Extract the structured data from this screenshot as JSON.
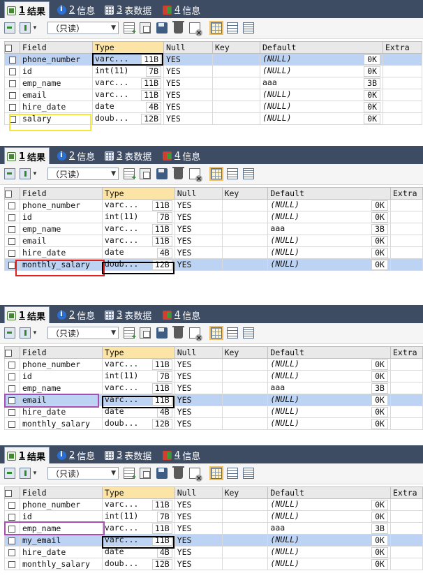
{
  "tabs": [
    {
      "num": "1",
      "label": "结果"
    },
    {
      "num": "2",
      "label": "信息"
    },
    {
      "num": "3",
      "label": "表数据"
    },
    {
      "num": "4",
      "label": "信息"
    }
  ],
  "toolbar": {
    "mode": "（只读）"
  },
  "columns": [
    "Field",
    "Type",
    "Null",
    "Key",
    "Default",
    "Extra"
  ],
  "panels": [
    {
      "highlight_color": "#f5e63a",
      "selected_row": 0,
      "highlight_row": 5,
      "rows": [
        {
          "field": "phone_number",
          "type": "varc...",
          "size": "11B",
          "null": "YES",
          "default": "(NULL)",
          "len": "0K"
        },
        {
          "field": "id",
          "type": "int(11)",
          "size": "7B",
          "null": "YES",
          "default": "(NULL)",
          "len": "0K"
        },
        {
          "field": "emp_name",
          "type": "varc...",
          "size": "11B",
          "null": "YES",
          "default": "aaa",
          "len": "3B"
        },
        {
          "field": "email",
          "type": "varc...",
          "size": "11B",
          "null": "YES",
          "default": "(NULL)",
          "len": "0K"
        },
        {
          "field": "hire_date",
          "type": "date",
          "size": "4B",
          "null": "YES",
          "default": "(NULL)",
          "len": "0K"
        },
        {
          "field": "salary",
          "type": "doub...",
          "size": "12B",
          "null": "YES",
          "default": "(NULL)",
          "len": "0K"
        }
      ]
    },
    {
      "highlight_color": "#e0201c",
      "selected_row": 5,
      "highlight_row": 5,
      "rows": [
        {
          "field": "phone_number",
          "type": "varc...",
          "size": "11B",
          "null": "YES",
          "default": "(NULL)",
          "len": "0K"
        },
        {
          "field": "id",
          "type": "int(11)",
          "size": "7B",
          "null": "YES",
          "default": "(NULL)",
          "len": "0K"
        },
        {
          "field": "emp_name",
          "type": "varc...",
          "size": "11B",
          "null": "YES",
          "default": "aaa",
          "len": "3B"
        },
        {
          "field": "email",
          "type": "varc...",
          "size": "11B",
          "null": "YES",
          "default": "(NULL)",
          "len": "0K"
        },
        {
          "field": "hire_date",
          "type": "date",
          "size": "4B",
          "null": "YES",
          "default": "(NULL)",
          "len": "0K"
        },
        {
          "field": "monthly_salary",
          "type": "doub...",
          "size": "12B",
          "null": "YES",
          "default": "(NULL)",
          "len": "0K"
        }
      ]
    },
    {
      "highlight_color": "#a64fb0",
      "selected_row": 3,
      "highlight_row": 3,
      "rows": [
        {
          "field": "phone_number",
          "type": "varc...",
          "size": "11B",
          "null": "YES",
          "default": "(NULL)",
          "len": "0K"
        },
        {
          "field": "id",
          "type": "int(11)",
          "size": "7B",
          "null": "YES",
          "default": "(NULL)",
          "len": "0K"
        },
        {
          "field": "emp_name",
          "type": "varc...",
          "size": "11B",
          "null": "YES",
          "default": "aaa",
          "len": "3B"
        },
        {
          "field": "email",
          "type": "varc...",
          "size": "11B",
          "null": "YES",
          "default": "(NULL)",
          "len": "0K"
        },
        {
          "field": "hire_date",
          "type": "date",
          "size": "4B",
          "null": "YES",
          "default": "(NULL)",
          "len": "0K"
        },
        {
          "field": "monthly_salary",
          "type": "doub...",
          "size": "12B",
          "null": "YES",
          "default": "(NULL)",
          "len": "0K"
        }
      ]
    },
    {
      "highlight_color": "#a64fb0",
      "selected_row": 3,
      "highlight_row": 2,
      "rows": [
        {
          "field": "phone_number",
          "type": "varc...",
          "size": "11B",
          "null": "YES",
          "default": "(NULL)",
          "len": "0K"
        },
        {
          "field": "id",
          "type": "int(11)",
          "size": "7B",
          "null": "YES",
          "default": "(NULL)",
          "len": "0K"
        },
        {
          "field": "emp_name",
          "type": "varc...",
          "size": "11B",
          "null": "YES",
          "default": "aaa",
          "len": "3B"
        },
        {
          "field": "my_email",
          "type": "varc...",
          "size": "11B",
          "null": "YES",
          "default": "(NULL)",
          "len": "0K"
        },
        {
          "field": "hire_date",
          "type": "date",
          "size": "4B",
          "null": "YES",
          "default": "(NULL)",
          "len": "0K"
        },
        {
          "field": "monthly_salary",
          "type": "doub...",
          "size": "12B",
          "null": "YES",
          "default": "(NULL)",
          "len": "0K"
        }
      ]
    }
  ]
}
